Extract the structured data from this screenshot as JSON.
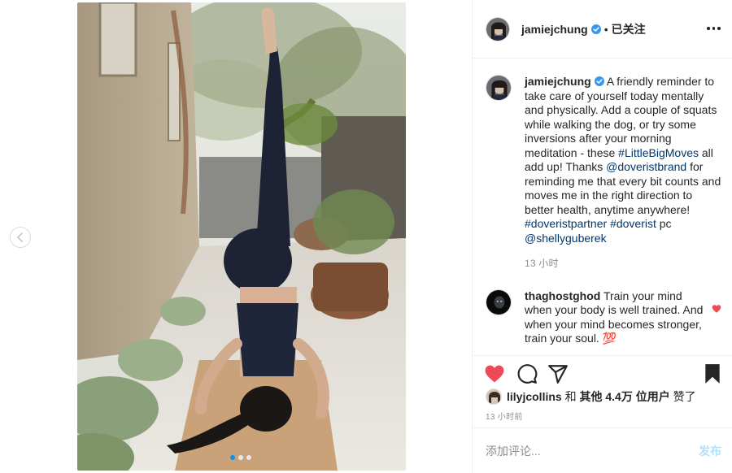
{
  "post": {
    "username": "jamiejchung",
    "separator": "•",
    "follow_label": "已关注",
    "verified_icon": "verified-badge-icon",
    "more_icon": "more-options-icon"
  },
  "caption": {
    "username": "jamiejchung",
    "text_1": "A friendly reminder to take care of yourself today mentally and physically. Add a couple of squats while walking the dog, or try some inversions after your morning meditation - these ",
    "hashtag_1": "#LittleBigMoves",
    "text_2": " all add up! Thanks ",
    "mention_1": "@doveristbrand",
    "text_3": " for reminding me that every bit counts and moves me in the right direction to better health, anytime anywhere! ",
    "hashtag_2": "#doveristpartner",
    "text_4": " ",
    "hashtag_3": "#doverist",
    "text_5": " pc ",
    "mention_2": "@shellyguberek",
    "time": "13 小时"
  },
  "comment": {
    "username": "thaghostghod",
    "text": " Train your mind when your body is well trained. And when your mind becomes stronger, train your soul. ",
    "emoji": "💯",
    "like_color": "#ed4956"
  },
  "likes": {
    "liker": "lilyjcollins",
    "middle": " 和 ",
    "others": "其他 4.4万 位用户",
    "suffix": " 赞了"
  },
  "post_time": "13 小时前",
  "add_comment": {
    "placeholder": "添加评论...",
    "post_label": "发布"
  },
  "colors": {
    "like_red": "#ed4956",
    "link_blue": "#00376b",
    "verified_blue": "#3897f0",
    "post_disabled": "#b2dffc",
    "carousel_active": "#0095f6"
  },
  "carousel": {
    "current": 1,
    "total": 3
  }
}
